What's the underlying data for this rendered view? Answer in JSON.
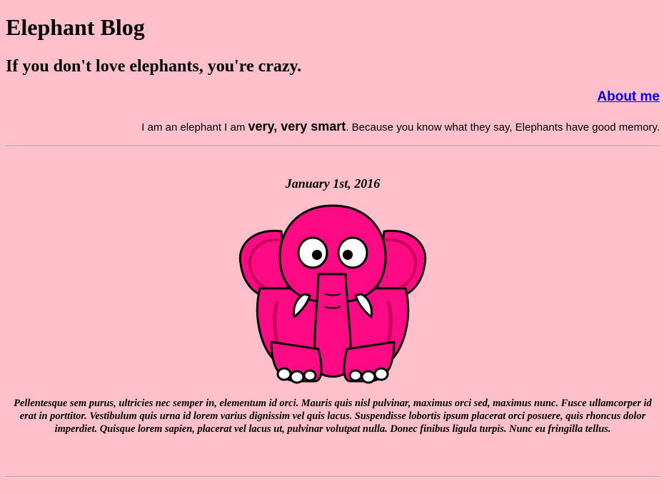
{
  "header": {
    "title": "Elephant Blog",
    "subtitle": "If you don't love elephants, you're crazy."
  },
  "about": {
    "link_label": "About me",
    "text_before": "I am an elephant I am ",
    "text_emphasis": "very, very smart",
    "text_after": ". Because you know what they say, Elephants have good memory."
  },
  "post": {
    "date": "January 1st, 2016",
    "image_icon": "pink-elephant-illustration",
    "body": "Pellentesque sem purus, ultricies nec semper in, elementum id orci. Mauris quis nisl pulvinar, maximus orci sed, maximus nunc. Fusce ullamcorper id erat in porttitor. Vestibulum quis urna id lorem varius dignissim vel quis lacus. Suspendisse lobortis ipsum placerat orci posuere, quis rhoncus dolor imperdiet. Quisque lorem sapien, placerat vel lacus ut, pulvinar volutpat nulla. Donec finibus ligula turpis. Nunc eu fringilla tellus."
  },
  "colors": {
    "background": "#ffc0cb",
    "link": "#0000ee",
    "elephant_body": "#ff0a85",
    "elephant_shadow": "#c8005a",
    "outline": "#000000"
  }
}
